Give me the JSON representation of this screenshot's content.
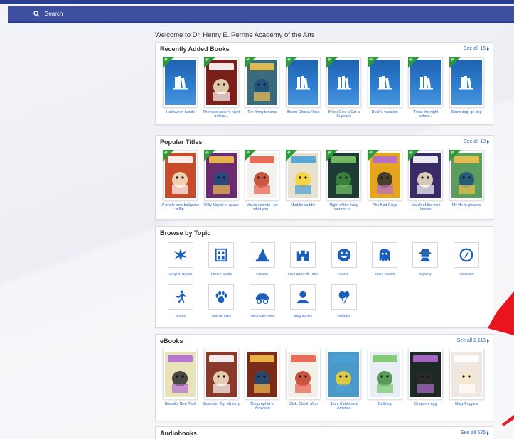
{
  "search": {
    "label": "Search"
  },
  "welcome": "Welcome to Dr. Henry E. Perrine Academy of the Arts",
  "ribbon_text": "IN",
  "recently_added": {
    "title": "Recently Added Books",
    "see_all": "See all 15",
    "books": [
      {
        "title": "Halloween hustle",
        "cover": "generic"
      },
      {
        "title": "The nutcracker's night before...",
        "cover": "nutcracker",
        "bg": "#7a1f1a"
      },
      {
        "title": "Ten flying brooms",
        "cover": "brooms",
        "bg": "#3b6a7a"
      },
      {
        "title": "Bloom Chicka Rock",
        "cover": "generic"
      },
      {
        "title": "If You Give a Cat a Cupcake",
        "cover": "generic"
      },
      {
        "title": "Duck's vacation",
        "cover": "generic"
      },
      {
        "title": "'Twas the night before...",
        "cover": "generic"
      },
      {
        "title": "Snow dog, go dog",
        "cover": "generic"
      }
    ]
  },
  "popular": {
    "title": "Popular Titles",
    "see_all": "See all 10",
    "books": [
      {
        "title": "A whole new ballgame : a flip...",
        "bg": "#c84b2a"
      },
      {
        "title": "Willy Maykit in space",
        "bg": "#6a2b6f"
      },
      {
        "title": "Maxi's secrets : (or what you...",
        "bg": "#f2f2ee"
      },
      {
        "title": "Muddle cuddle",
        "bg": "#e7e2cf"
      },
      {
        "title": "Night of the living worms : a...",
        "bg": "#1f3b36"
      },
      {
        "title": "The Bad Guys",
        "bg": "#e6a51f"
      },
      {
        "title": "March of the mini beasts",
        "bg": "#3a2a66"
      },
      {
        "title": "My life in pictures",
        "bg": "#5a9d5c"
      }
    ]
  },
  "topics": {
    "title": "Browse by Topic",
    "items": [
      {
        "label": "Graphic Novels",
        "icon": "burst-icon"
      },
      {
        "label": "Picture Books",
        "icon": "picture-book-icon"
      },
      {
        "label": "Fantasy",
        "icon": "wizard-hat-icon"
      },
      {
        "label": "Fairy and Folk Tales",
        "icon": "castle-icon"
      },
      {
        "label": "Humor",
        "icon": "smiley-icon"
      },
      {
        "label": "Scary Stories",
        "icon": "ghost-icon"
      },
      {
        "label": "Mystery",
        "icon": "spy-icon"
      },
      {
        "label": "Adventure",
        "icon": "compass-icon"
      },
      {
        "label": "Sports",
        "icon": "runner-icon"
      },
      {
        "label": "Animal Tales",
        "icon": "paw-icon"
      },
      {
        "label": "Historical Fiction",
        "icon": "wagon-icon"
      },
      {
        "label": "Biographies",
        "icon": "person-icon"
      },
      {
        "label": "Holidays",
        "icon": "balloons-icon"
      }
    ]
  },
  "ebooks": {
    "title": "eBooks",
    "see_all": "See all 2,115",
    "books": [
      {
        "title": "Biscuit's New Trick",
        "bg": "#e9e4b8"
      },
      {
        "title": "Mountain Top Mystery",
        "bg": "#8a3a2a"
      },
      {
        "title": "The prophet of Yonwood",
        "bg": "#7a2b1a"
      },
      {
        "title": "Click, Clack, Moo",
        "bg": "#f1f1ea"
      },
      {
        "title": "Stunt Cat Across America",
        "bg": "#4a9ac8"
      },
      {
        "title": "Bullying",
        "bg": "#e8eef5"
      },
      {
        "title": "Dragon's egg",
        "bg": "#1d2a24"
      },
      {
        "title": "Mary Poppins",
        "bg": "#f0e8e0"
      }
    ]
  },
  "audiobooks": {
    "title": "Audiobooks",
    "see_all": "See all 525"
  },
  "colors": {
    "accent": "#2d66c4",
    "ribbon": "#2e9b3a",
    "header": "#3e4f9f",
    "arrow": "#e8141e"
  }
}
